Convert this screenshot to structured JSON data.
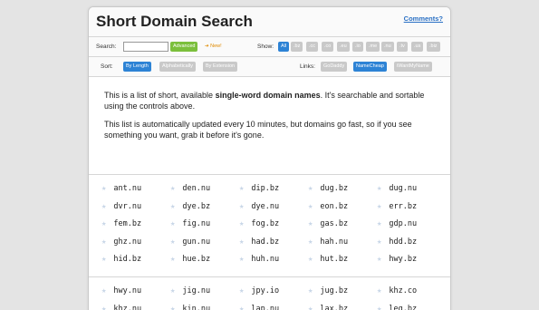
{
  "header": {
    "title": "Short Domain Search",
    "comments_link": "Comments?"
  },
  "search": {
    "label": "Search:",
    "placeholder": "",
    "advanced_label": "Advanced",
    "new_badge": "➔ New!"
  },
  "show": {
    "label": "Show:",
    "filters": [
      "All",
      ".bz",
      ".cc",
      ".co",
      ".eu",
      ".io",
      ".me",
      ".nu",
      ".tv",
      ".us",
      ".biz"
    ]
  },
  "sort": {
    "label": "Sort:",
    "options": [
      "By Length",
      "Alphabetically",
      "By Extension"
    ]
  },
  "links": {
    "label": "Links:",
    "options": [
      "GoDaddy",
      "NameCheap",
      "iWantMyName"
    ]
  },
  "intro": {
    "p1_prefix": "This is a list of short, available ",
    "p1_bold": "single-word domain names",
    "p1_suffix": ". It's searchable and sortable using the controls above.",
    "p2": "This list is automatically updated every 10 minutes, but domains go fast, so if you see something you want, grab it before it's gone."
  },
  "domains_group1": [
    [
      "ant.nu",
      "den.nu",
      "dip.bz",
      "dug.bz",
      "dug.nu"
    ],
    [
      "dvr.nu",
      "dye.bz",
      "dye.nu",
      "eon.bz",
      "err.bz"
    ],
    [
      "fem.bz",
      "fig.nu",
      "fog.bz",
      "gas.bz",
      "gdp.nu"
    ],
    [
      "ghz.nu",
      "gun.nu",
      "had.bz",
      "hah.nu",
      "hdd.bz"
    ],
    [
      "hid.bz",
      "hue.bz",
      "huh.nu",
      "hut.bz",
      "hwy.bz"
    ]
  ],
  "domains_group2": [
    [
      "hwy.nu",
      "jig.nu",
      "jpy.io",
      "jug.bz",
      "khz.co"
    ],
    [
      "khz.nu",
      "kin.nu",
      "lap.nu",
      "lax.bz",
      "leg.bz"
    ]
  ],
  "colors": {
    "accent": "#2d83d5",
    "advanced": "#7bbf3c",
    "link": "#2a70c4",
    "star": "#c9d7e8"
  }
}
